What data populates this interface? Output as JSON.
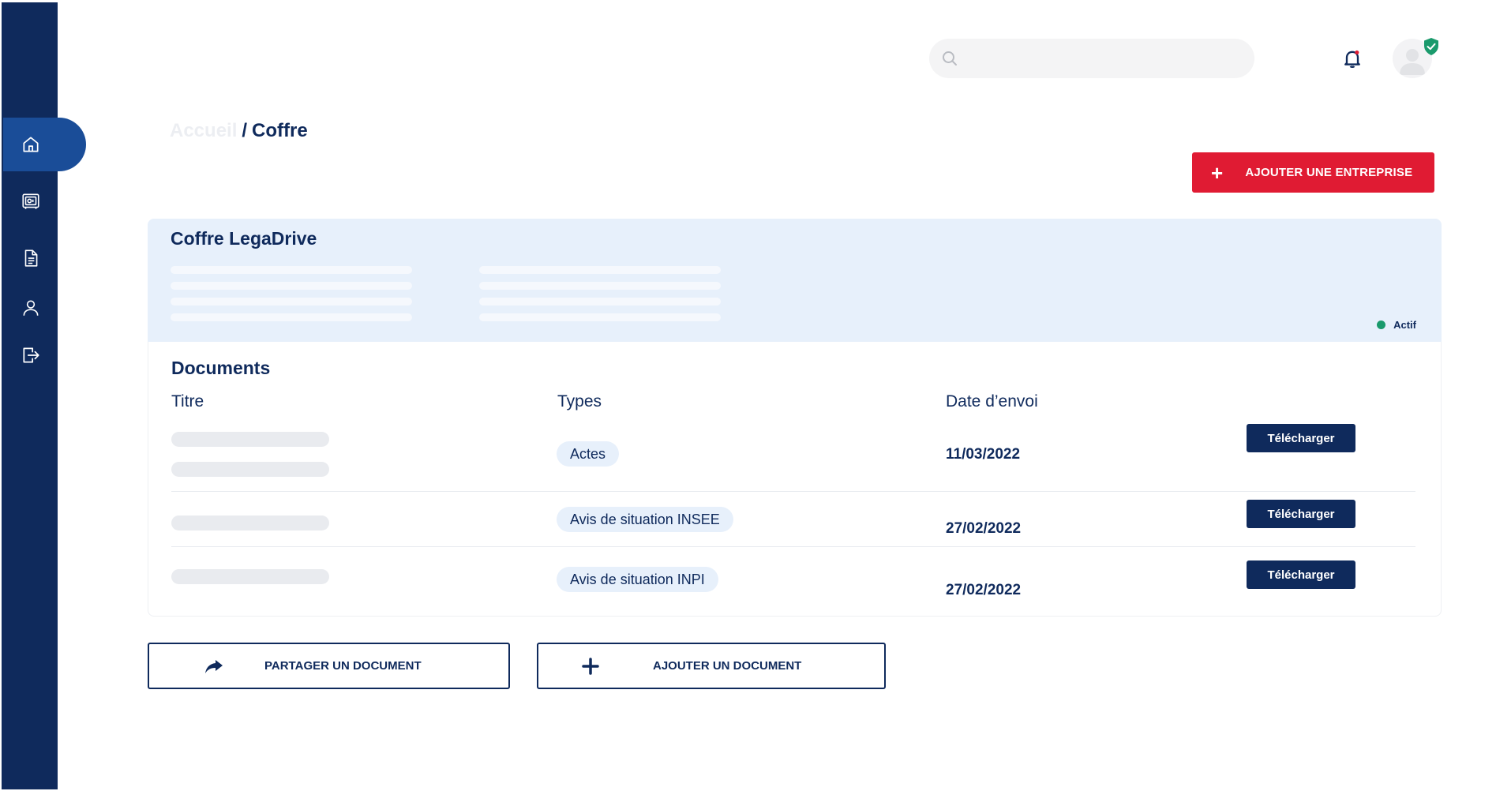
{
  "header": {
    "search": {
      "placeholder": "",
      "value": ""
    },
    "icons": {
      "search": "search-icon",
      "notifications": "bell-icon",
      "avatar": "user-avatar-icon",
      "verified": "shield-check-icon"
    }
  },
  "sidebar": {
    "items": [
      {
        "icon": "home-icon",
        "active": true
      },
      {
        "icon": "vault-icon",
        "active": false
      },
      {
        "icon": "document-icon",
        "active": false
      },
      {
        "icon": "user-icon",
        "active": false
      },
      {
        "icon": "logout-icon",
        "active": false
      }
    ]
  },
  "breadcrumb": {
    "home": "Accueil",
    "separator": "/",
    "current": "Coffre"
  },
  "actions": {
    "add_company": "AJOUTER UNE ENTREPRISE"
  },
  "vault": {
    "title": "Coffre LegaDrive",
    "status": "Actif"
  },
  "documents": {
    "title": "Documents",
    "columns": {
      "title": "Titre",
      "types": "Types",
      "date": "Date d’envoi"
    },
    "rows": [
      {
        "type": "Actes",
        "date": "11/03/2022",
        "action": "Télécharger"
      },
      {
        "type": "Avis de situation INSEE",
        "date": "27/02/2022",
        "action": "Télécharger"
      },
      {
        "type": "Avis de situation INPI",
        "date": "27/02/2022",
        "action": "Télécharger"
      }
    ]
  },
  "footer_actions": {
    "share": "PARTAGER UN DOCUMENT",
    "add_document": "AJOUTER UN DOCUMENT"
  },
  "colors": {
    "navy": "#0f2a5c",
    "active_nav": "#1a4d98",
    "accent_red": "#e01b33",
    "card_bg": "#e7f0fb",
    "status_green": "#1a9a6c"
  }
}
